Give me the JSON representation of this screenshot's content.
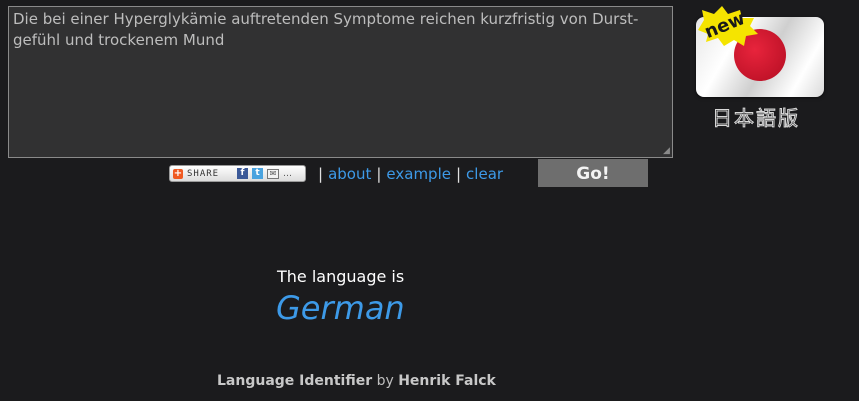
{
  "input": {
    "text": "Die bei einer Hyperglykämie auftretenden Symptome reichen kurzfristig von Durst-\ngefühl und trockenem Mund"
  },
  "share": {
    "label": "SHARE",
    "icons": [
      "facebook-icon",
      "twitter-icon",
      "email-icon",
      "more-icon"
    ]
  },
  "links": {
    "separator": "|",
    "about": "about",
    "example": "example",
    "clear": "clear"
  },
  "go_button": "Go!",
  "japan_promo": {
    "badge": "new",
    "caption": "日本語版"
  },
  "result": {
    "prefix": "The language is",
    "language": "German"
  },
  "footer": {
    "app_name": "Language Identifier",
    "by": "by",
    "author": "Henrik Falck"
  },
  "colors": {
    "background": "#1b1b1d",
    "link": "#3d9ae8",
    "go_button": "#6e6e6e",
    "new_badge": "#f5e400"
  }
}
